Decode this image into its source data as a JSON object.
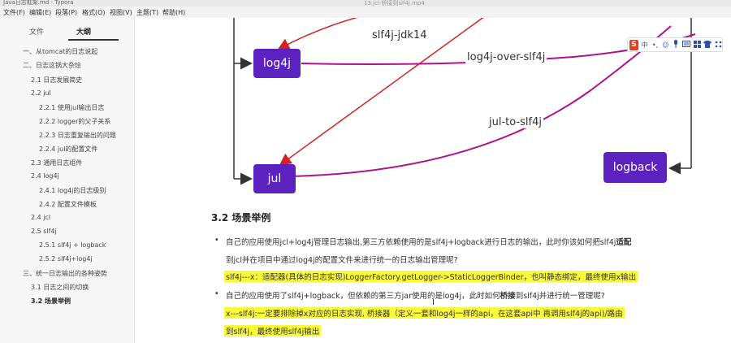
{
  "window": {
    "title": "Java日志框架.md - Typora",
    "video_title": "13.jcl-桥接到slf4j.mp4"
  },
  "menu": [
    "文件(F)",
    "编辑(E)",
    "段落(P)",
    "格式(O)",
    "视图(V)",
    "主题(T)",
    "帮助(H)"
  ],
  "sidebar": {
    "tabs": [
      "文件",
      "大纲"
    ],
    "active_tab": "大纲",
    "outline": [
      "一、从tomcat的日志说起",
      "二、日志这锅大杂烩",
      "2.1 日志发展简史",
      "2.2 jul",
      "2.2.1 使用jul输出日志",
      "2.2.2 logger的父子关系",
      "2.2.3 日志重复输出的问题",
      "2.2.4 jul的配置文件",
      "2.3 通用日志组件",
      "2.4 log4j",
      "2.4.1 log4j的日志级别",
      "2.4.2 配置文件模板",
      "2.4 jcl",
      "2.5 slf4j",
      "2.5.1 slf4j + logback",
      "2.5.2 slf4j+log4j",
      "三、统一日志输出的各种姿势",
      "3.1 日志之间的切换",
      "3.2 场景举例"
    ]
  },
  "diagram": {
    "nodes": {
      "log4j": "log4j",
      "jul": "jul",
      "logback": "logback"
    },
    "edges": {
      "slf4j_jdk14": "slf4j-jdk14",
      "log4j_over_slf4j": "log4j-over-slf4j",
      "jul_to_slf4j": "jul-to-slf4j"
    },
    "colors": {
      "node": "#5b22c0",
      "red_arrow": "#d42222",
      "purple_line": "#b0128a"
    }
  },
  "article": {
    "heading": "3.2 场景举例",
    "bullet1": {
      "line1_pre": "自己的应用使用jcl+log4j管理日志输出,第三方依赖使用的是slf4j+logback进行日志的输出，此时你该如何把slf4j",
      "line1_bold": "适配",
      "line2": "到jcl并在项目中通过log4j的配置文件来进行统一的日志输出管理呢?",
      "answer": "slf4j---x：适配器(具体的日志实现)LoggerFactory.getLogger->StaticLoggerBinder，也叫静态绑定，最终使用x输出"
    },
    "bullet2": {
      "line1_pre": "自己的应用使用了slf4j+logback，但依赖的第三方jar使用的是log4j，此时如何",
      "line1_bold": "桥接",
      "line1_post": "到slf4j并进行统一管理呢?",
      "answer1": "x---slf4j:一定要排除掉x对应的日志实现, 桥接器（定义一套和log4j一样的api，在这套api中 再调用slf4j的api)/路由",
      "answer2": "到slf4j，最终使用slf4j输出"
    }
  },
  "ime_toolbar": {
    "logo": "S",
    "items": [
      "中",
      "•,",
      "☺",
      "mic",
      "kbd",
      "grid",
      "shirt",
      "apps"
    ]
  }
}
